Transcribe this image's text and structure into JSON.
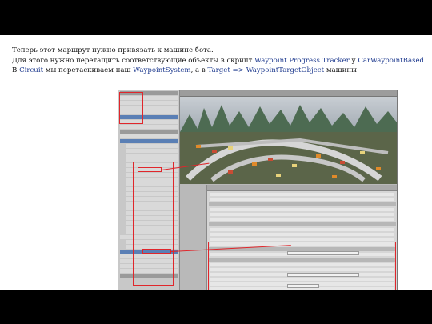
{
  "text": {
    "line1": "Теперь этот маршрут нужно привязать к машине бота.",
    "line2_prefix": "Для этого нужно перетащить соответствующие объекты в скрипт ",
    "line2_script": "Waypoint Progress Tracker",
    "line2_mid": " у ",
    "line2_object": "CarWaypointBased",
    "line3_prefix": "В ",
    "line3_circuit": "Circuit",
    "line3_mid": " мы перетаскиваем наш ",
    "line3_system": "WaypointSystem",
    "line3_mid2": ", а в ",
    "line3_target": "Target",
    "line3_arrow": " => ",
    "line3_target_object": "WaypointTargetObject",
    "line3_suffix": " машины"
  },
  "colors": {
    "highlight": "#1f3b8f",
    "annotation": "#e0262b"
  }
}
